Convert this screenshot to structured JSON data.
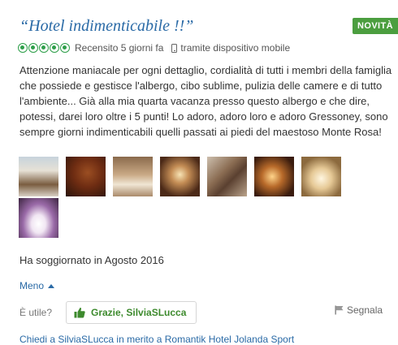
{
  "review": {
    "title": "“Hotel indimenticabile !!”",
    "badge": "NOVITÀ",
    "rating": 5,
    "reviewed_date": "Recensito 5 giorni fa",
    "device_text": "tramite dispositivo mobile",
    "body": "Attenzione maniacale per ogni dettaglio, cordialità di tutti i membri della famiglia che possiede e gestisce l'albergo, cibo sublime, pulizia delle camere e di tutto l'ambiente... Già alla mia quarta vacanza presso questo albergo e che dire, potessi, darei loro oltre i 5 punti! Lo adoro, adoro loro e adoro Gressoney, sono sempre giorni indimenticabili quelli passati ai piedi del maestoso Monte Rosa!",
    "photo_count": 8,
    "stay_text": "Ha soggiornato in Agosto 2016",
    "less_link": "Meno"
  },
  "actions": {
    "useful_label": "È utile?",
    "thanks_button": "Grazie, SilviaSLucca",
    "report_label": "Segnala",
    "ask_link": "Chiedi a SilviaSLucca in merito a Romantik Hotel Jolanda Sport"
  },
  "colors": {
    "title_blue": "#2a6aa6",
    "badge_green": "#4b9e3f",
    "rating_green": "#2e9f4a",
    "thanks_green": "#3d8a2d"
  },
  "icons": [
    "rating-bubble-icon",
    "mobile-phone-icon",
    "caret-up-icon",
    "thumbs-up-icon",
    "flag-icon"
  ]
}
